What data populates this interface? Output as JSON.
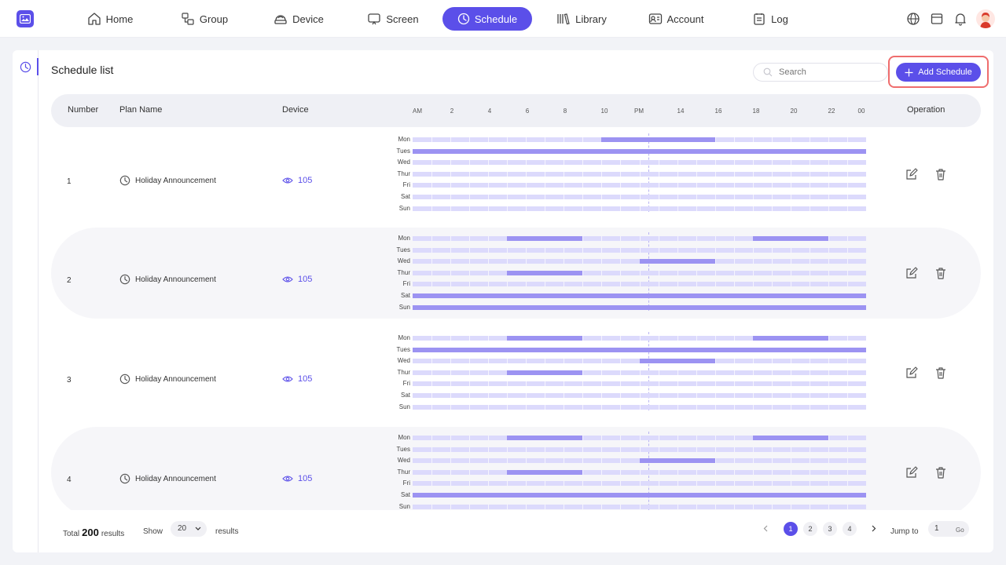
{
  "nav": {
    "items": [
      {
        "label": "Home",
        "icon": "home-icon"
      },
      {
        "label": "Group",
        "icon": "group-icon"
      },
      {
        "label": "Device",
        "icon": "device-icon"
      },
      {
        "label": "Screen",
        "icon": "screen-icon"
      },
      {
        "label": "Schedule",
        "icon": "clock-icon",
        "active": true
      },
      {
        "label": "Library",
        "icon": "library-icon"
      },
      {
        "label": "Account",
        "icon": "account-icon"
      },
      {
        "label": "Log",
        "icon": "log-icon"
      }
    ],
    "right_icons": [
      "globe-icon",
      "store-icon",
      "bell-icon",
      "avatar"
    ]
  },
  "colors": {
    "accent": "#5b4fe9",
    "track": "#dcdafc",
    "segment": "#9c93f2",
    "highlight": "#ef6d6d"
  },
  "page": {
    "title": "Schedule list",
    "search_placeholder": "Search",
    "add_button": "Add Schedule"
  },
  "table": {
    "headers": {
      "number": "Number",
      "plan": "Plan Name",
      "device": "Device",
      "operation": "Operation"
    },
    "time_ticks": [
      "AM",
      "2",
      "4",
      "6",
      "8",
      "10",
      "PM",
      "14",
      "16",
      "18",
      "20",
      "22",
      "00"
    ],
    "days": [
      "Mon",
      "Tues",
      "Wed",
      "Thur",
      "Fri",
      "Sat",
      "Sun"
    ],
    "rows": [
      {
        "number": "1",
        "plan": "Holiday Announcement",
        "device": "105",
        "schedule": {
          "Mon": [
            [
              10,
              16
            ]
          ],
          "Tues": [
            [
              0,
              24
            ]
          ],
          "Wed": [],
          "Thur": [],
          "Fri": [],
          "Sat": [],
          "Sun": []
        }
      },
      {
        "number": "2",
        "plan": "Holiday Announcement",
        "device": "105",
        "schedule": {
          "Mon": [
            [
              5,
              9
            ],
            [
              18,
              22
            ]
          ],
          "Tues": [],
          "Wed": [
            [
              12,
              16
            ]
          ],
          "Thur": [
            [
              5,
              9
            ]
          ],
          "Fri": [],
          "Sat": [
            [
              0,
              24
            ]
          ],
          "Sun": [
            [
              0,
              24
            ]
          ]
        }
      },
      {
        "number": "3",
        "plan": "Holiday Announcement",
        "device": "105",
        "schedule": {
          "Mon": [
            [
              5,
              9
            ],
            [
              18,
              22
            ]
          ],
          "Tues": [
            [
              0,
              24
            ]
          ],
          "Wed": [
            [
              12,
              16
            ]
          ],
          "Thur": [
            [
              5,
              9
            ]
          ],
          "Fri": [],
          "Sat": [],
          "Sun": []
        }
      },
      {
        "number": "4",
        "plan": "Holiday Announcement",
        "device": "105",
        "schedule": {
          "Mon": [
            [
              5,
              9
            ],
            [
              18,
              22
            ]
          ],
          "Tues": [],
          "Wed": [
            [
              12,
              16
            ]
          ],
          "Thur": [
            [
              5,
              9
            ]
          ],
          "Fri": [],
          "Sat": [
            [
              0,
              24
            ]
          ],
          "Sun": []
        }
      }
    ]
  },
  "footer": {
    "total_prefix": "Total",
    "total_count": "200",
    "total_suffix": "results",
    "show_label": "Show",
    "page_size": "20",
    "results_label": "results",
    "pages": [
      "1",
      "2",
      "3",
      "4"
    ],
    "current_page": "1",
    "jump_label": "Jump to",
    "jump_value": "1",
    "go_label": "Go"
  }
}
